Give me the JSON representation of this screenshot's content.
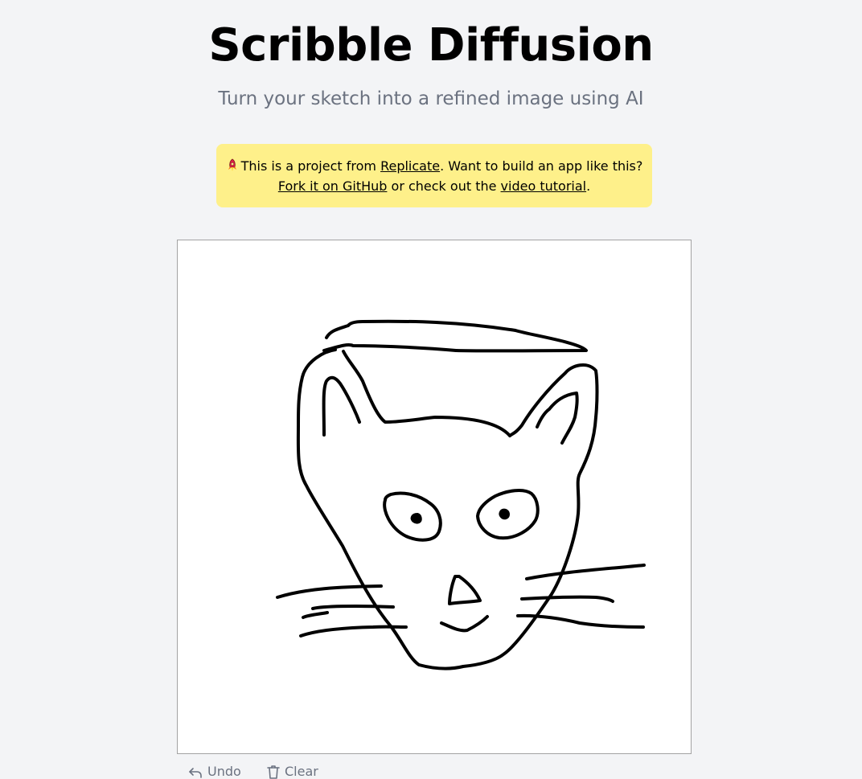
{
  "header": {
    "title": "Scribble Diffusion",
    "subtitle": "Turn your sketch into a refined image using AI"
  },
  "notice": {
    "icon": "rocket-emoji-icon",
    "text_1": "This is a project from ",
    "link_replicate": "Replicate",
    "text_2": ". Want to build an app like this?",
    "link_github": "Fork it on GitHub",
    "text_3": " or check out the ",
    "link_tutorial": "video tutorial",
    "text_4": ".",
    "background": "#fef08a"
  },
  "canvas": {
    "stroke_color": "#000000",
    "background": "#ffffff"
  },
  "toolbar": {
    "undo_label": "Undo",
    "clear_label": "Clear",
    "undo_icon": "undo-icon",
    "clear_icon": "trash-icon"
  }
}
